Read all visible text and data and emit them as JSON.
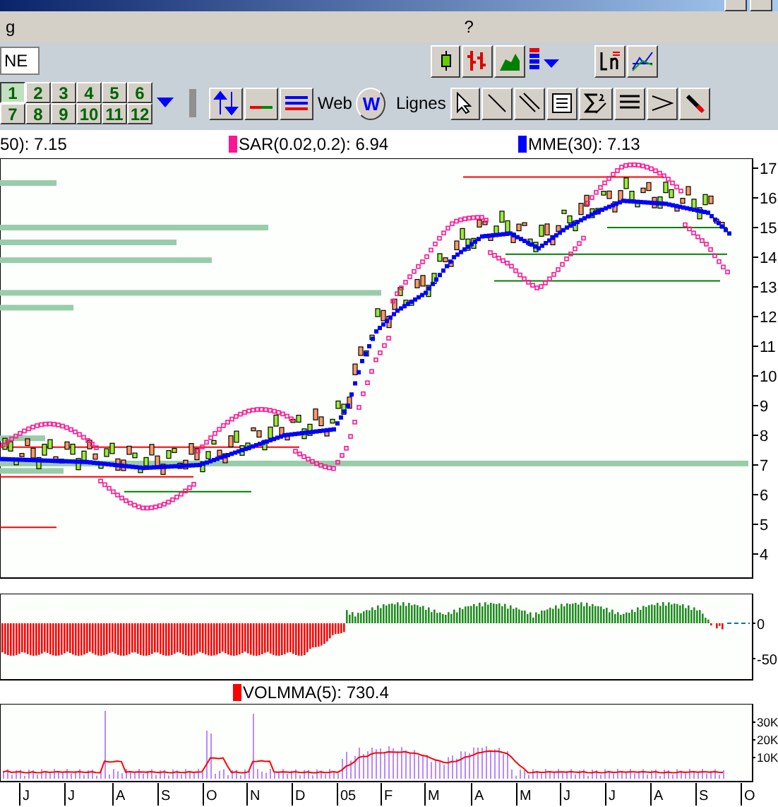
{
  "menu": [
    {
      "label": "g"
    },
    {
      "label": "?"
    }
  ],
  "symbol_field": {
    "value": "NE"
  },
  "period_buttons": [
    {
      "label": "1",
      "selected": true
    },
    {
      "label": "2",
      "selected": false
    },
    {
      "label": "3",
      "selected": false
    },
    {
      "label": "4",
      "selected": false
    },
    {
      "label": "5",
      "selected": false
    },
    {
      "label": "6",
      "selected": false
    },
    {
      "label": "7",
      "selected": false
    },
    {
      "label": "8",
      "selected": false
    },
    {
      "label": "9",
      "selected": false
    },
    {
      "label": "10",
      "selected": false
    },
    {
      "label": "11",
      "selected": false
    },
    {
      "label": "12",
      "selected": false
    }
  ],
  "web_label": "Web",
  "web_button": "W",
  "lines_label": "Lignes",
  "legend": [
    {
      "text": "50):  7.15"
    },
    {
      "text": "SAR(0.02,0.2):  6.94",
      "color": "#ff1493"
    },
    {
      "text": "MME(30):  7.13",
      "color": "#0000ff"
    }
  ],
  "price_axis": [
    "17",
    "16",
    "15",
    "14",
    "13",
    "12",
    "11",
    "10",
    "9",
    "8",
    "7",
    "6",
    "5",
    "4"
  ],
  "oscillator_axis": [
    "0",
    "-50"
  ],
  "volume_legend": {
    "text": "VOLMMA(5):  730.4",
    "color": "#ff0000"
  },
  "volume_axis": [
    "30K",
    "20K",
    "10K"
  ],
  "months": [
    "J",
    "J",
    "A",
    "S",
    "O",
    "N",
    "D",
    "05",
    "F",
    "M",
    "A",
    "M",
    "J",
    "J",
    "A",
    "S",
    "O"
  ]
}
